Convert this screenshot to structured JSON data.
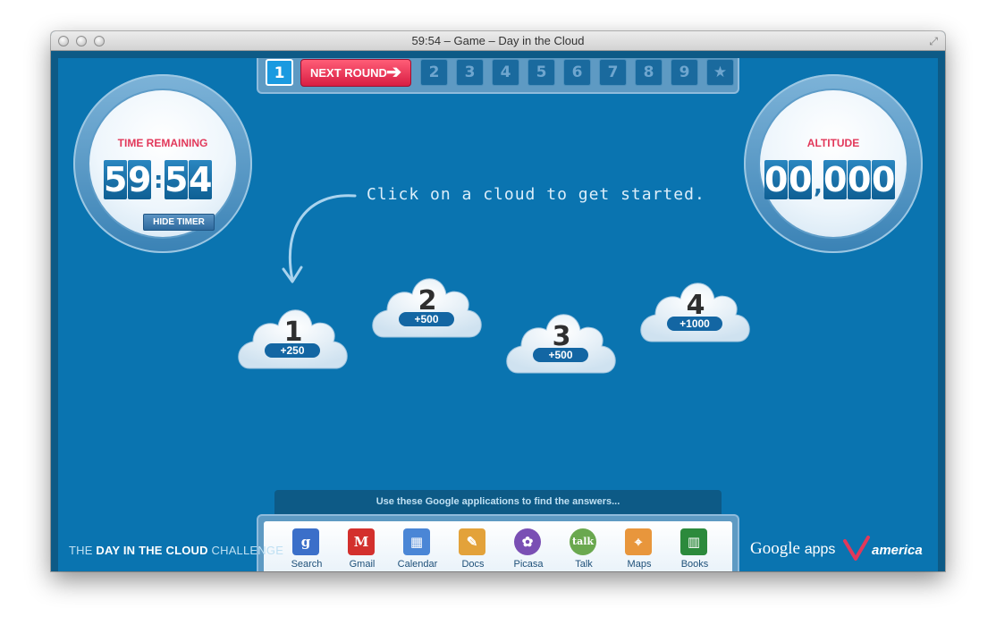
{
  "window": {
    "title": "59:54 – Game – Day in the Cloud"
  },
  "rounds": {
    "current": "1",
    "next_label": "NEXT ROUND",
    "items": [
      "2",
      "3",
      "4",
      "5",
      "6",
      "7",
      "8",
      "9",
      "★"
    ]
  },
  "timer": {
    "label": "TIME REMAINING",
    "digits": [
      "5",
      "9",
      "5",
      "4"
    ],
    "separator": ":",
    "hide_label": "HIDE TIMER"
  },
  "altitude": {
    "label": "ALTITUDE",
    "digits": [
      "0",
      "0",
      "0",
      "0",
      "0"
    ],
    "separator": ","
  },
  "hint": {
    "text": "Click on a cloud to get started."
  },
  "clouds": [
    {
      "number": "1",
      "points": "+250"
    },
    {
      "number": "2",
      "points": "+500"
    },
    {
      "number": "3",
      "points": "+500"
    },
    {
      "number": "4",
      "points": "+1000"
    }
  ],
  "apps": {
    "caption": "Use these Google applications to find the answers...",
    "items": [
      {
        "label": "Search",
        "icon": "google-search-icon",
        "color": "#3b6fc9"
      },
      {
        "label": "Gmail",
        "icon": "gmail-icon",
        "color": "#d3302d"
      },
      {
        "label": "Calendar",
        "icon": "calendar-icon",
        "color": "#4a86d6"
      },
      {
        "label": "Docs",
        "icon": "docs-icon",
        "color": "#e3a23a"
      },
      {
        "label": "Picasa",
        "icon": "picasa-icon",
        "color": "#7a4fb4"
      },
      {
        "label": "Talk",
        "icon": "talk-icon",
        "color": "#6aa84f"
      },
      {
        "label": "Maps",
        "icon": "maps-icon",
        "color": "#e8963c"
      },
      {
        "label": "Books",
        "icon": "books-icon",
        "color": "#2c8a3c"
      }
    ]
  },
  "footer": {
    "challenge_prefix": "THE ",
    "challenge_bold": "DAY IN THE CLOUD",
    "challenge_suffix": " CHALLENGE",
    "google": "Google",
    "apps": "apps",
    "virgin": "america"
  },
  "colors": {
    "stage": "#0a74b0",
    "accent": "#e2385a",
    "digit": "#1470aa"
  }
}
